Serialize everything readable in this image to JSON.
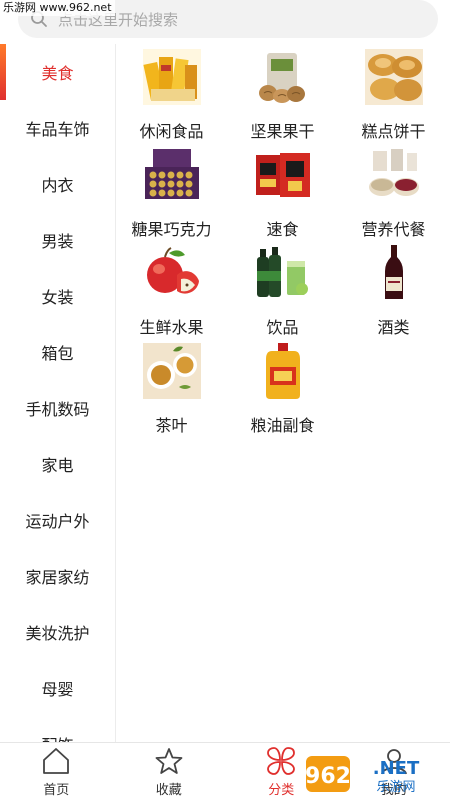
{
  "watermark": {
    "text": "乐游网 www.962.net"
  },
  "search": {
    "placeholder": "点击这里开始搜索",
    "icon": "search-icon"
  },
  "colors": {
    "accent": "#e0302e",
    "sidebar_border": "#ececec",
    "search_bg": "#f2f2f2"
  },
  "sidebar": {
    "active_index": 0,
    "items": [
      {
        "label": "美食"
      },
      {
        "label": "车品车饰"
      },
      {
        "label": "内衣"
      },
      {
        "label": "男装"
      },
      {
        "label": "女装"
      },
      {
        "label": "箱包"
      },
      {
        "label": "手机数码"
      },
      {
        "label": "家电"
      },
      {
        "label": "运动户外"
      },
      {
        "label": "家居家纺"
      },
      {
        "label": "美妆洗护"
      },
      {
        "label": "母婴"
      },
      {
        "label": "配饰"
      }
    ]
  },
  "categories": [
    {
      "label": "休闲食品",
      "icon": "snack-pack-image"
    },
    {
      "label": "坚果果干",
      "icon": "nuts-bag-image"
    },
    {
      "label": "糕点饼干",
      "icon": "pastry-image"
    },
    {
      "label": "糖果巧克力",
      "icon": "chocolate-box-image"
    },
    {
      "label": "速食",
      "icon": "instant-noodle-image"
    },
    {
      "label": "营养代餐",
      "icon": "grain-bowls-image"
    },
    {
      "label": "生鲜水果",
      "icon": "apple-image"
    },
    {
      "label": "饮品",
      "icon": "drink-bottles-image"
    },
    {
      "label": "酒类",
      "icon": "wine-bottle-image"
    },
    {
      "label": "茶叶",
      "icon": "tea-cups-image"
    },
    {
      "label": "粮油副食",
      "icon": "cooking-oil-image"
    }
  ],
  "tabbar": {
    "active_index": 2,
    "tabs": [
      {
        "label": "首页",
        "icon": "home-icon"
      },
      {
        "label": "收藏",
        "icon": "star-icon"
      },
      {
        "label": "分类",
        "icon": "category-clover-icon"
      },
      {
        "label": "我的",
        "icon": "profile-icon"
      }
    ]
  },
  "brand": {
    "text": "962.NET",
    "subtext": "乐游网"
  }
}
